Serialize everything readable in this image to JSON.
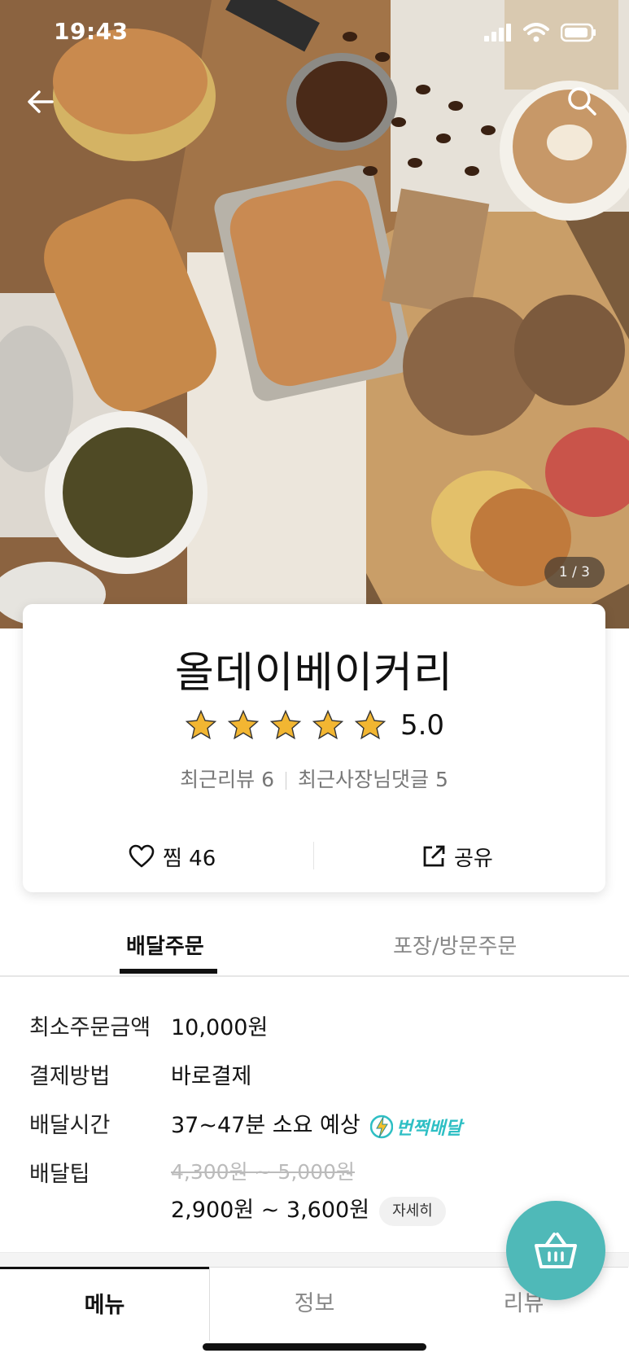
{
  "status_bar": {
    "time": "19:43"
  },
  "hero": {
    "counter": "1 / 3"
  },
  "store": {
    "name": "올데이베이커리",
    "rating": "5.0",
    "stars": 5,
    "recent_reviews_label": "최근리뷰 6",
    "owner_comments_label": "최근사장님댓글 5",
    "like_label": "찜 46",
    "share_label": "공유"
  },
  "order_tabs": {
    "delivery": "배달주문",
    "pickup": "포장/방문주문"
  },
  "info": {
    "min_order_label": "최소주문금액",
    "min_order_value": "10,000원",
    "payment_label": "결제방법",
    "payment_value": "바로결제",
    "delivery_time_label": "배달시간",
    "delivery_time_value": "37~47분 소요 예상",
    "express_badge": "번쩍배달",
    "delivery_tip_label": "배달팁",
    "delivery_tip_original": "4,300원 ~ 5,000원",
    "delivery_tip_value": "2,900원 ~ 3,600원",
    "detail_button": "자세히"
  },
  "bottom_tabs": {
    "menu": "메뉴",
    "info": "정보",
    "review": "리뷰"
  },
  "colors": {
    "accent": "#4fb9b8",
    "express": "#2ebfc4",
    "star": "#f2b632"
  }
}
